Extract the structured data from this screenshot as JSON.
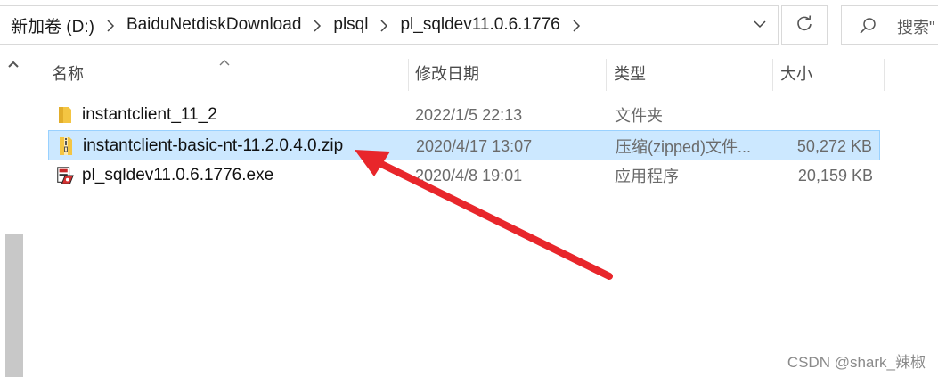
{
  "address_bar": {
    "breadcrumbs": [
      "新加卷 (D:)",
      "BaiduNetdiskDownload",
      "plsql",
      "pl_sqldev11.0.6.1776"
    ]
  },
  "search": {
    "placeholder": "搜索\""
  },
  "columns": {
    "name": "名称",
    "date_modified": "修改日期",
    "type": "类型",
    "size": "大小"
  },
  "files": [
    {
      "name": "instantclient_11_2",
      "date": "2022/1/5 22:13",
      "type": "文件夹",
      "size": "",
      "icon": "folder-icon",
      "selected": false
    },
    {
      "name": "instantclient-basic-nt-11.2.0.4.0.zip",
      "date": "2020/4/17 13:07",
      "type": "压缩(zipped)文件...",
      "size": "50,272 KB",
      "icon": "zip-folder-icon",
      "selected": true
    },
    {
      "name": "pl_sqldev11.0.6.1776.exe",
      "date": "2020/4/8 19:01",
      "type": "应用程序",
      "size": "20,159 KB",
      "icon": "installer-exe-icon",
      "selected": false
    }
  ],
  "annotation": {
    "color": "#e8262b"
  },
  "colors": {
    "selection_bg": "#cce8ff",
    "selection_border": "#99d1ff",
    "folder": "#f4c542"
  },
  "watermark": "CSDN @shark_辣椒"
}
